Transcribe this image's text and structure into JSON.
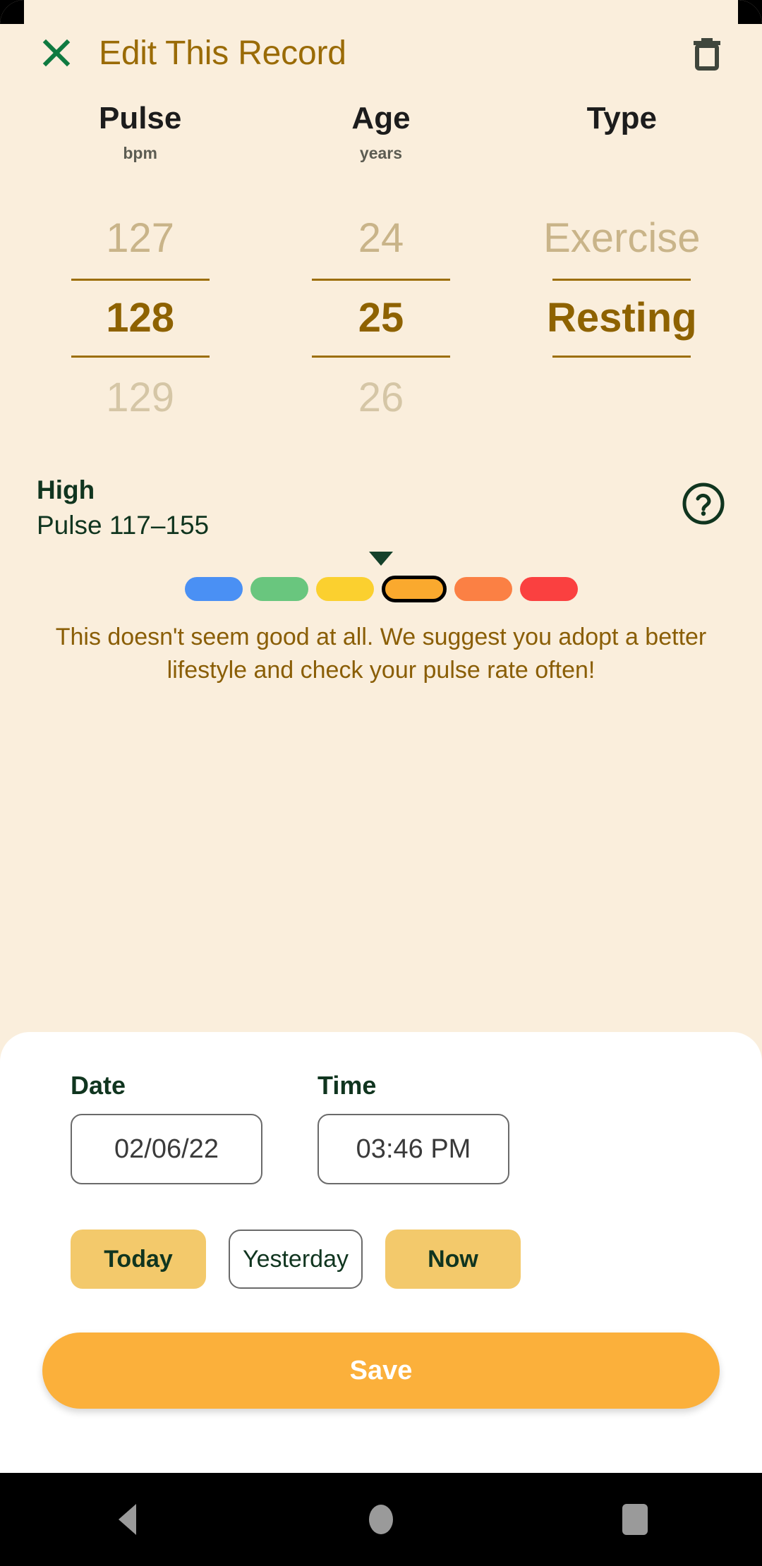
{
  "header": {
    "close_icon": "close-x-icon",
    "title": "Edit This Record",
    "delete_icon": "trash-icon"
  },
  "picker": {
    "columns": [
      {
        "title": "Pulse",
        "unit": "bpm",
        "previous": "127",
        "selected": "128",
        "next": "129"
      },
      {
        "title": "Age",
        "unit": "years",
        "previous": "24",
        "selected": "25",
        "next": "26"
      },
      {
        "title": "Type",
        "unit": "",
        "previous": "Exercise",
        "selected": "Resting",
        "next": ""
      }
    ]
  },
  "status": {
    "level": "High",
    "range": "Pulse 117–155",
    "help_icon": "question-mark-circle-icon",
    "caret_icon": "caret-down-icon",
    "advice": "This doesn't seem good at all. We suggest you adopt a better lifestyle and check your pulse rate often!",
    "scale": [
      {
        "name": "blue",
        "color": "#4A90F4",
        "selected": false
      },
      {
        "name": "green",
        "color": "#69C67E",
        "selected": false
      },
      {
        "name": "yellow",
        "color": "#FBD02F",
        "selected": false
      },
      {
        "name": "orange",
        "color": "#FAA92E",
        "selected": true
      },
      {
        "name": "deep-orange",
        "color": "#FB8044",
        "selected": false
      },
      {
        "name": "red",
        "color": "#FA4040",
        "selected": false
      }
    ]
  },
  "sheet": {
    "date": {
      "label": "Date",
      "value": "02/06/22"
    },
    "time": {
      "label": "Time",
      "value": "03:46 PM"
    },
    "quick": [
      {
        "label": "Today",
        "style": "filled"
      },
      {
        "label": "Yesterday",
        "style": "outline"
      },
      {
        "label": "Now",
        "style": "filled"
      }
    ],
    "save_label": "Save"
  },
  "navbar": {
    "back": "back-triangle-icon",
    "home": "home-circle-icon",
    "recents": "recents-square-icon"
  },
  "colors": {
    "background": "#FAEEDC",
    "accent_amber": "#FBB03B",
    "title_gold": "#9A6B06",
    "dark_green": "#10351F",
    "selected_gold": "#8E6200"
  }
}
